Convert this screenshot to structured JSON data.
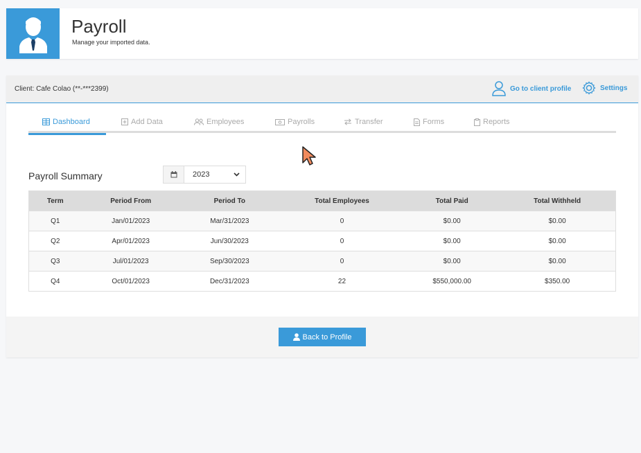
{
  "header": {
    "title": "Payroll",
    "subtitle": "Manage your imported data.",
    "icon": "user-tie-icon"
  },
  "client_bar": {
    "client_label": "Client: Cafe Colao (**-***2399)",
    "go_to_profile_label": "Go to client profile",
    "settings_label": "Settings"
  },
  "tabs": [
    {
      "label": "Dashboard",
      "icon": "table-icon",
      "active": true
    },
    {
      "label": "Add Data",
      "icon": "plus-square-icon",
      "active": false
    },
    {
      "label": "Employees",
      "icon": "users-icon",
      "active": false
    },
    {
      "label": "Payrolls",
      "icon": "money-icon",
      "active": false
    },
    {
      "label": "Transfer",
      "icon": "exchange-icon",
      "active": false
    },
    {
      "label": "Forms",
      "icon": "file-icon",
      "active": false
    },
    {
      "label": "Reports",
      "icon": "clipboard-icon",
      "active": false
    }
  ],
  "summary": {
    "title": "Payroll Summary",
    "year": "2023"
  },
  "table": {
    "headers": [
      "Term",
      "Period From",
      "Period To",
      "Total Employees",
      "Total Paid",
      "Total Withheld"
    ],
    "rows": [
      [
        "Q1",
        "Jan/01/2023",
        "Mar/31/2023",
        "0",
        "$0.00",
        "$0.00"
      ],
      [
        "Q2",
        "Apr/01/2023",
        "Jun/30/2023",
        "0",
        "$0.00",
        "$0.00"
      ],
      [
        "Q3",
        "Jul/01/2023",
        "Sep/30/2023",
        "0",
        "$0.00",
        "$0.00"
      ],
      [
        "Q4",
        "Oct/01/2023",
        "Dec/31/2023",
        "22",
        "$550,000.00",
        "$350.00"
      ]
    ]
  },
  "footer": {
    "back_label": "Back to Profile"
  },
  "colors": {
    "accent": "#3a9ad9"
  }
}
